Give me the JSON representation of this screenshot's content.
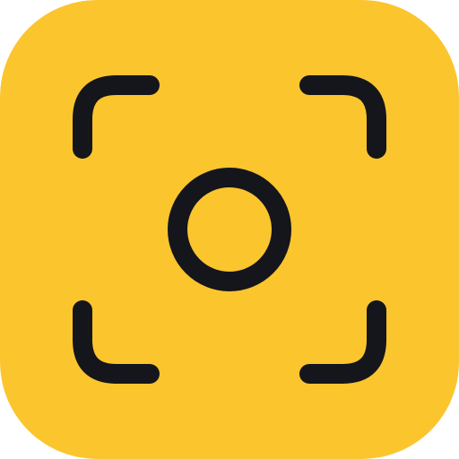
{
  "app_icon": {
    "icon_name": "camera-viewfinder-icon",
    "colors": {
      "background": "#FBC52E",
      "stroke": "#15161B"
    }
  }
}
